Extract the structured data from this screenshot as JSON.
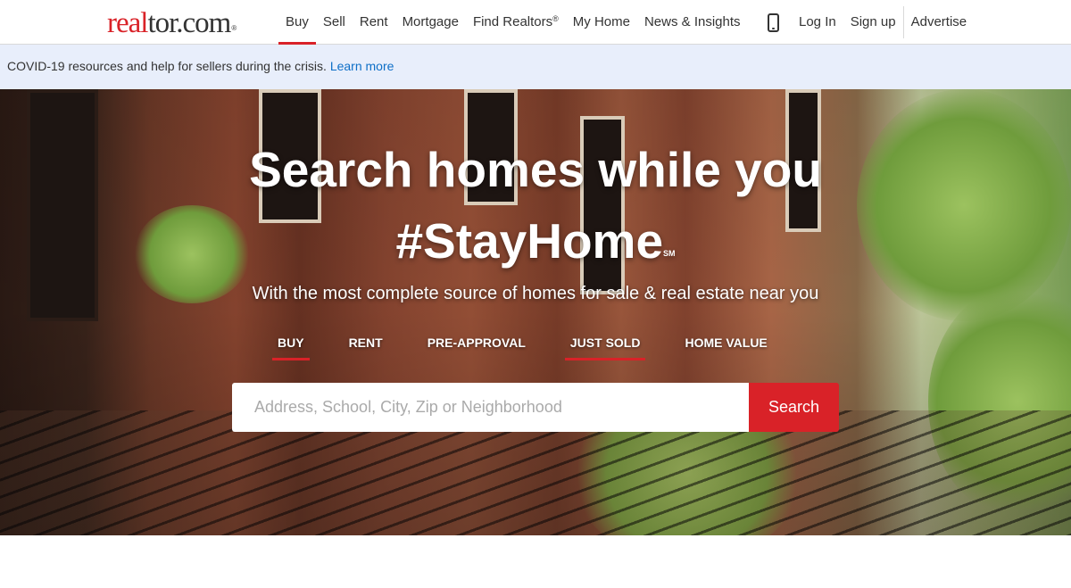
{
  "logo": {
    "part1": "real",
    "part2": "tor.com",
    "mark": "®"
  },
  "nav": {
    "items": [
      {
        "label": "Buy",
        "active": true
      },
      {
        "label": "Sell"
      },
      {
        "label": "Rent"
      },
      {
        "label": "Mortgage"
      },
      {
        "label": "Find Realtors",
        "sup": "®"
      },
      {
        "label": "My Home"
      },
      {
        "label": "News & Insights"
      }
    ],
    "phone_icon": "mobile-phone-icon",
    "login": "Log In",
    "signup": "Sign up",
    "advertise": "Advertise"
  },
  "banner": {
    "text": "COVID-19 resources and help for sellers during the crisis.",
    "link": "Learn more",
    "background": "#e8eefb",
    "link_color": "#0e6fc7"
  },
  "hero": {
    "title_line1": "Search homes while you",
    "title_line2": "#StayHome",
    "title_mark": "SM",
    "subtitle": "With the most complete source of homes for sale & real estate near you",
    "tabs": [
      {
        "label": "BUY",
        "active": true
      },
      {
        "label": "RENT"
      },
      {
        "label": "PRE-APPROVAL"
      },
      {
        "label": "JUST SOLD",
        "active": true
      },
      {
        "label": "HOME VALUE"
      }
    ],
    "search_placeholder": "Address, School, City, Zip or Neighborhood",
    "search_button": "Search"
  },
  "colors": {
    "accent": "#d92228",
    "text": "#333333"
  }
}
